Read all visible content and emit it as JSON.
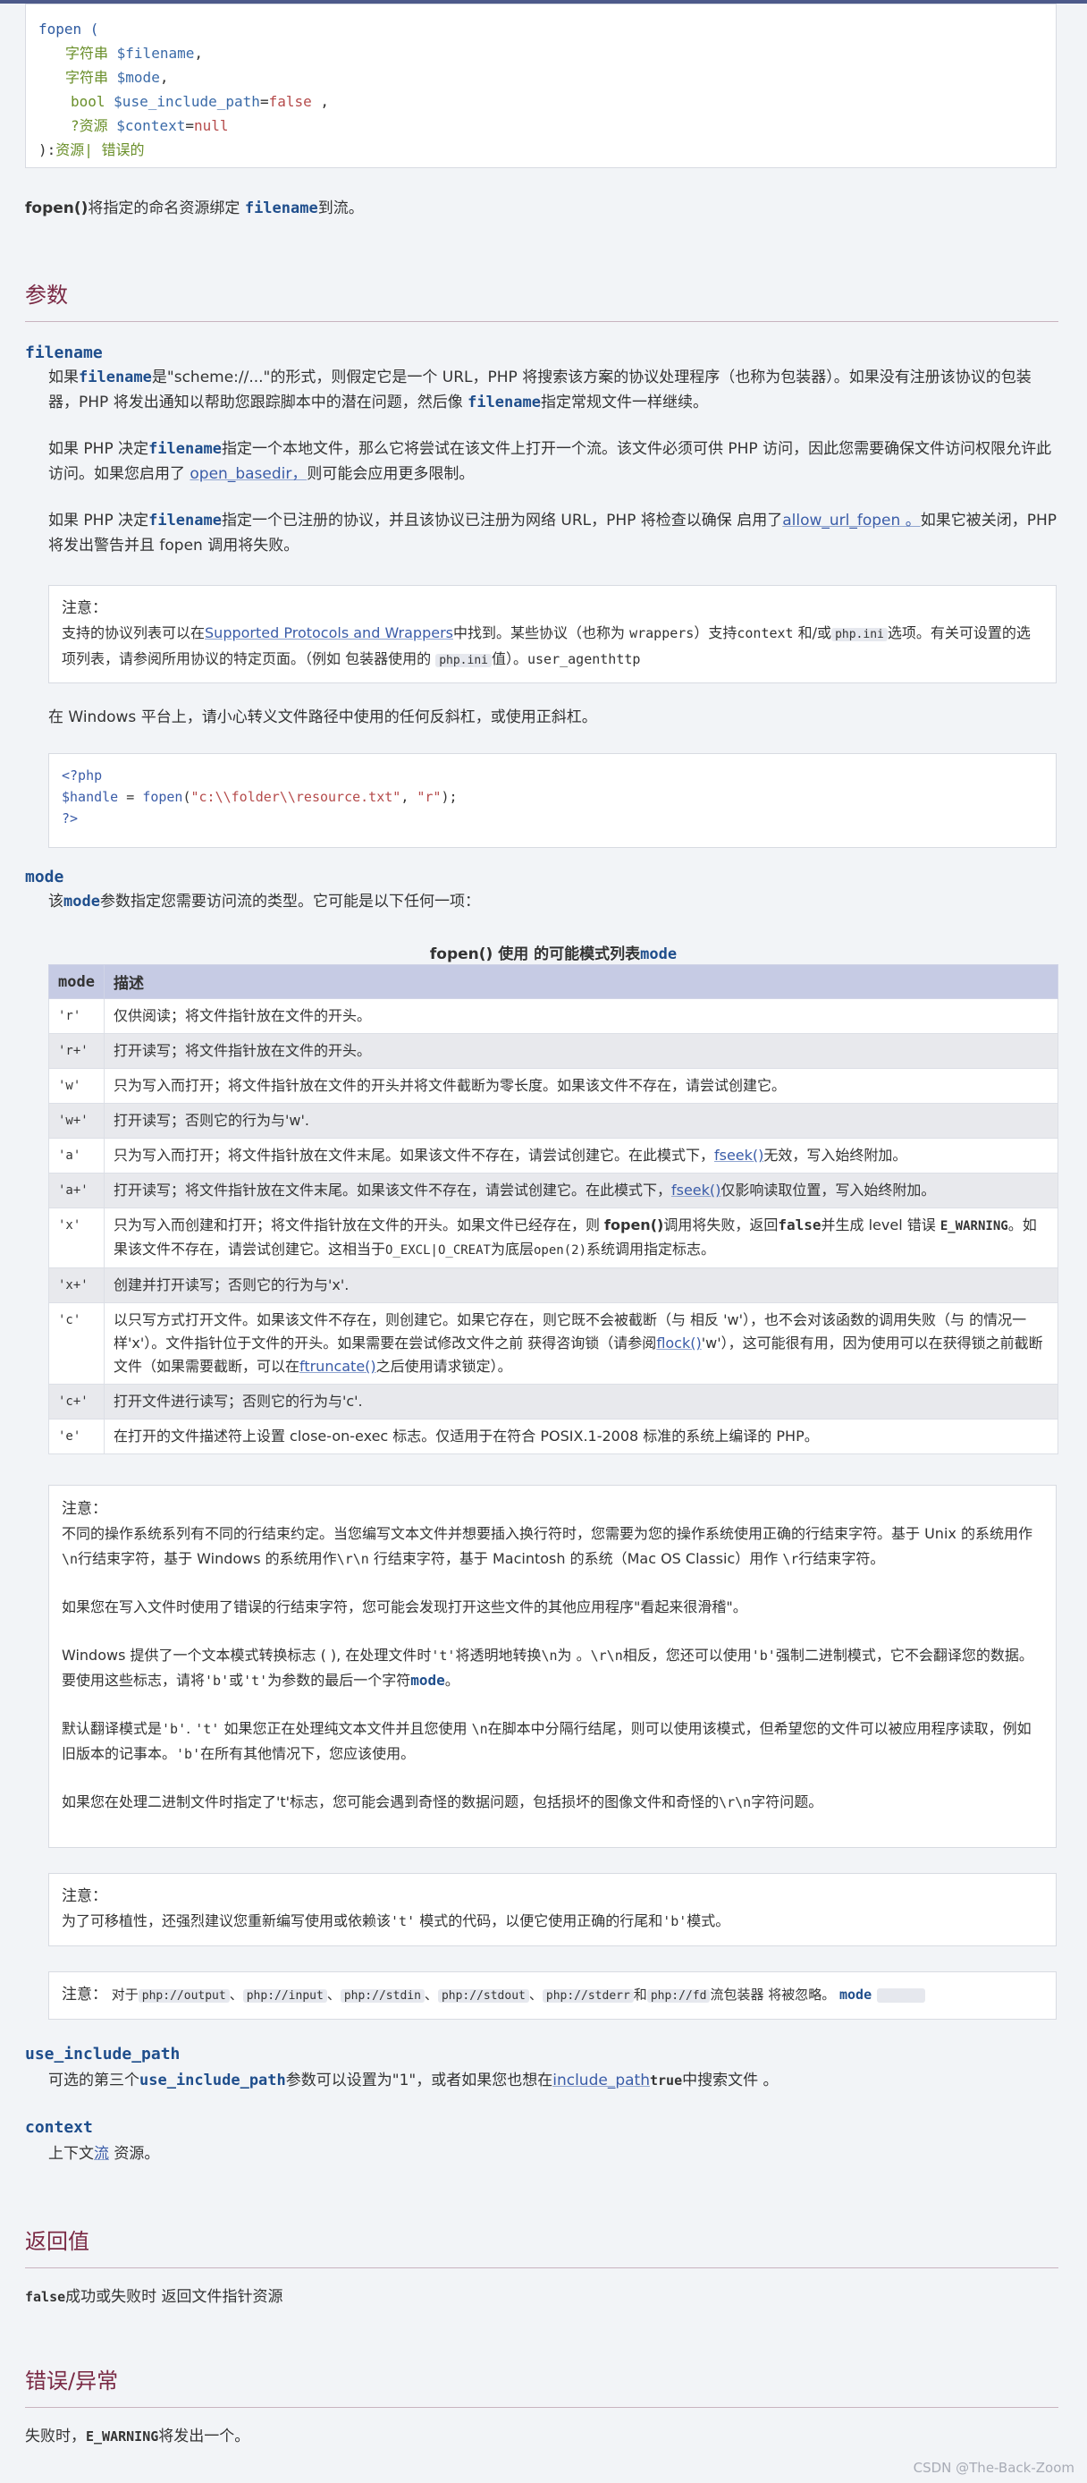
{
  "synopsis": {
    "fn": "fopen (",
    "params": [
      {
        "type": "字符串",
        "var": "$filename",
        "suffix": ","
      },
      {
        "type": "字符串",
        "var": "$mode",
        "suffix": ","
      },
      {
        "type": "bool",
        "var": "$use_include_path",
        "default": "false",
        "suffix": " ,"
      },
      {
        "type": "?资源",
        "var": "$context",
        "default": "null",
        "suffix": ""
      }
    ],
    "ret_prefix": "):",
    "ret": "资源| 错误的"
  },
  "description": {
    "fn": "fopen()",
    "text1": "将指定的命名资源绑定 ",
    "param": "filename",
    "text2": "到流。"
  },
  "sections": {
    "params": "参数",
    "return": "返回值",
    "errors": "错误/异常"
  },
  "filename": {
    "term": "filename",
    "p1": [
      "如果",
      "filename",
      "是\"scheme://...\"的形式，则假定它是一个 URL，PHP 将搜索该方案的协议处理程序（也称为包装器）。如果没有注册该协议的包装器，PHP 将发出通知以帮助您跟踪脚本中的潜在问题，然后像 ",
      "filename",
      "指定常规文件一样继续。"
    ],
    "p2": [
      "如果 PHP 决定",
      "filename",
      "指定一个本地文件，那么它将尝试在该文件上打开一个流。该文件必须可供 PHP 访问，因此您需要确保文件访问权限允许此访问。如果您启用了 ",
      "open_basedir，",
      "则可能会应用更多限制。"
    ],
    "p3": [
      "如果 PHP 决定",
      "filename",
      "指定一个已注册的协议，并且该协议已注册为网络 URL，PHP 将检查以确保 启用了",
      "allow_url_fopen 。",
      "如果它被关闭，PHP 将发出警告并且 fopen 调用将失败。"
    ],
    "note1": {
      "title": "注意：",
      "t1": "支持的协议列表可以在",
      "link": "Supported Protocols and Wrappers",
      "t2": "中找到。某些协议（也称为 ",
      "c1": "wrappers",
      "t3": "）支持",
      "c2": "context",
      "t4": " 和/或",
      "c3": "php.ini",
      "t5": "选项。有关可设置的选项列表，请参阅所用协议的特定页面。（例如 包装器使用的 ",
      "c4": "php.ini",
      "t6": "值）。",
      "c5": "user_agenthttp"
    },
    "p4": "在 Windows 平台上，请小心转义文件路径中使用的任何反斜杠，或使用正斜杠。",
    "code": {
      "open": "<?php",
      "var": "$handle",
      "eq": " = ",
      "fn": "fopen",
      "lp": "(",
      "s1": "\"c:\\\\folder\\\\resource.txt\"",
      "comma": ", ",
      "s2": "\"r\"",
      "rp": ");",
      "close": "?>"
    }
  },
  "mode": {
    "term": "mode",
    "intro": [
      "该",
      "mode",
      "参数指定您需要访问流的类型。它可能是以下任何一项："
    ],
    "caption_pre": "fopen() 使用 的可能模式列表",
    "caption_param": "mode",
    "headers": [
      "mode",
      "描述"
    ],
    "rows": [
      {
        "m": "'r'",
        "d": "仅供阅读；将文件指针放在文件的开头。"
      },
      {
        "m": "'r+'",
        "d": "打开读写；将文件指针放在文件的开头。"
      },
      {
        "m": "'w'",
        "d": "只为写入而打开；将文件指针放在文件的开头并将文件截断为零长度。如果该文件不存在，请尝试创建它。"
      },
      {
        "m": "'w+'",
        "d": "打开读写；否则它的行为与'w'."
      },
      {
        "m": "'a'",
        "d1": "只为写入而打开；将文件指针放在文件末尾。如果该文件不存在，请尝试创建它。在此模式下，",
        "link": "fseek()",
        "d2": "无效，写入始终附加。"
      },
      {
        "m": "'a+'",
        "d1": "打开读写；将文件指针放在文件末尾。如果该文件不存在，请尝试创建它。在此模式下，",
        "link": "fseek()",
        "d2": "仅影响读取位置，写入始终附加。"
      },
      {
        "m": "'x'",
        "d1": "只为写入而创建和打开；将文件指针放在文件的开头。如果文件已经存在，则 ",
        "b1": "fopen()",
        "d2": "调用将失败，返回",
        "b2": "false",
        "d3": "并生成 level 错误 ",
        "b3": "E_WARNING",
        "d4": "。如果该文件不存在，请尝试创建它。这相当于",
        "c1": "O_EXCL|O_CREAT",
        "d5": "为底层",
        "c2": "open(2)",
        "d6": "系统调用指定标志。"
      },
      {
        "m": "'x+'",
        "d": "创建并打开读写；否则它的行为与'x'."
      },
      {
        "m": "'c'",
        "d1": "以只写方式打开文件。如果该文件不存在，则创建它。如果它存在，则它既不会被截断（与 相反 'w'），也不会对该函数的调用失败（与 的情况一样'x'）。文件指针位于文件的开头。如果需要在尝试修改文件之前 获得咨询锁（请参阅",
        "link1": "flock()",
        "d2": "'w'），这可能很有用，因为使用可以在获得锁之前截断文件（如果需要截断，可以在",
        "link2": "ftruncate()",
        "d3": "之后使用请求锁定）。"
      },
      {
        "m": "'c+'",
        "d": "打开文件进行读写；否则它的行为与'c'."
      },
      {
        "m": "'e'",
        "d": "在打开的文件描述符上设置 close-on-exec 标志。仅适用于在符合 POSIX.1-2008 标准的系统上编译的 PHP。"
      }
    ],
    "note2": {
      "title": "注意：",
      "p1_a": "不同的操作系统系列有不同的行结束约定。当您编写文本文件并想要插入换行符时，您需要为您的操作系统使用正确的行结束字符。基于 Unix 的系统用作",
      "p1_c1": "\\n",
      "p1_b": "行结束字符，基于 Windows 的系统用作",
      "p1_c2": "\\r\\n",
      "p1_c": " 行结束字符，基于 Macintosh 的系统（Mac OS Classic）用作 ",
      "p1_c3": "\\r",
      "p1_d": "行结束字符。",
      "p2": "如果您在写入文件时使用了错误的行结束字符，您可能会发现打开这些文件的其他应用程序\"看起来很滑稽\"。",
      "p3_a": "Windows 提供了一个文本模式转换标志 ( ), 在处理文件时",
      "p3_c1": "'t'",
      "p3_b": "将透明地转换",
      "p3_c2": "\\n",
      "p3_c": "为 。",
      "p3_c3": "\\r\\n",
      "p3_d": "相反，您还可以使用",
      "p3_c4": "'b'",
      "p3_e": "强制二进制模式，它不会翻译您的数据。要使用这些标志，请将",
      "p3_c5": "'b'",
      "p3_f": "或",
      "p3_c6": "'t'",
      "p3_g": "为参数的最后一个字符",
      "p3_param": "mode",
      "p3_h": "。",
      "p4_a": "默认翻译模式是",
      "p4_c1": "'b'",
      "p4_b": ". ",
      "p4_c2": "'t'",
      "p4_c": " 如果您正在处理纯文本文件并且您使用 ",
      "p4_c3": "\\n",
      "p4_d": "在脚本中分隔行结尾，则可以使用该模式，但希望您的文件可以被应用程序读取，例如旧版本的记事本。",
      "p4_c4": "'b'",
      "p4_e": "在所有其他情况下，您应该使用。",
      "p5_a": "如果您在处理二进制文件时指定了't'标志，您可能会遇到奇怪的数据问题，包括损坏的图像文件和奇怪的",
      "p5_c1": "\\r\\n",
      "p5_b": "字符问题。"
    },
    "note3": {
      "title": "注意：",
      "a": "为了可移植性，还强烈建议您重新编写使用或依赖该",
      "c1": "'t'",
      "b": " 模式的代码，以便它使用正确的行尾和",
      "c2": "'b'",
      "c": "模式。"
    },
    "note4": {
      "title": "注意：",
      "a": " 对于",
      "c1": "php://output",
      "s1": "、",
      "c2": "php://input",
      "s2": "、",
      "c3": "php://stdin",
      "s3": "、",
      "c4": "php://stdout",
      "s4": "、",
      "c5": "php://stderr",
      "s5": "和",
      "c6": "php://fd",
      "b": "流包装器 将被忽略。",
      "param": "mode"
    }
  },
  "use_include_path": {
    "term": "use_include_path",
    "a": "可选的第三个",
    "param": "use_include_path",
    "b": "参数可以设置为\"1\"，或者如果您也想在",
    "link": "include_path",
    "strong": "true",
    "c": "中搜索文件 。"
  },
  "context": {
    "term": "context",
    "a": "上下文",
    "link": "流",
    "b": " 资源。"
  },
  "return": {
    "strong": "false",
    "text": "成功或失败时 返回文件指针资源"
  },
  "errors": {
    "a": "失败时，",
    "strong": "E_WARNING",
    "b": "将发出一个。"
  },
  "watermark": "CSDN @The-Back-Zoom"
}
